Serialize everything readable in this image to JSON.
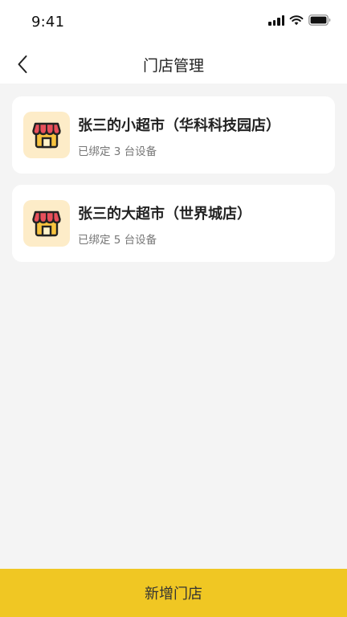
{
  "status_bar": {
    "time": "9:41",
    "icons": [
      "signal-icon",
      "wifi-icon",
      "battery-icon"
    ]
  },
  "nav": {
    "back_icon": "chevron-left-icon",
    "title": "门店管理"
  },
  "stores": [
    {
      "icon": "storefront-icon",
      "name": "张三的小超市（华科科技园店）",
      "subtitle": "已绑定 3 台设备"
    },
    {
      "icon": "storefront-icon",
      "name": "张三的大超市（世界城店）",
      "subtitle": "已绑定 5 台设备"
    }
  ],
  "footer": {
    "add_button_label": "新增门店"
  },
  "colors": {
    "accent": "#f0c723",
    "icon_bg": "#fdecc8",
    "awning": "#e8505b",
    "house": "#f7c33f",
    "outline": "#222222"
  }
}
